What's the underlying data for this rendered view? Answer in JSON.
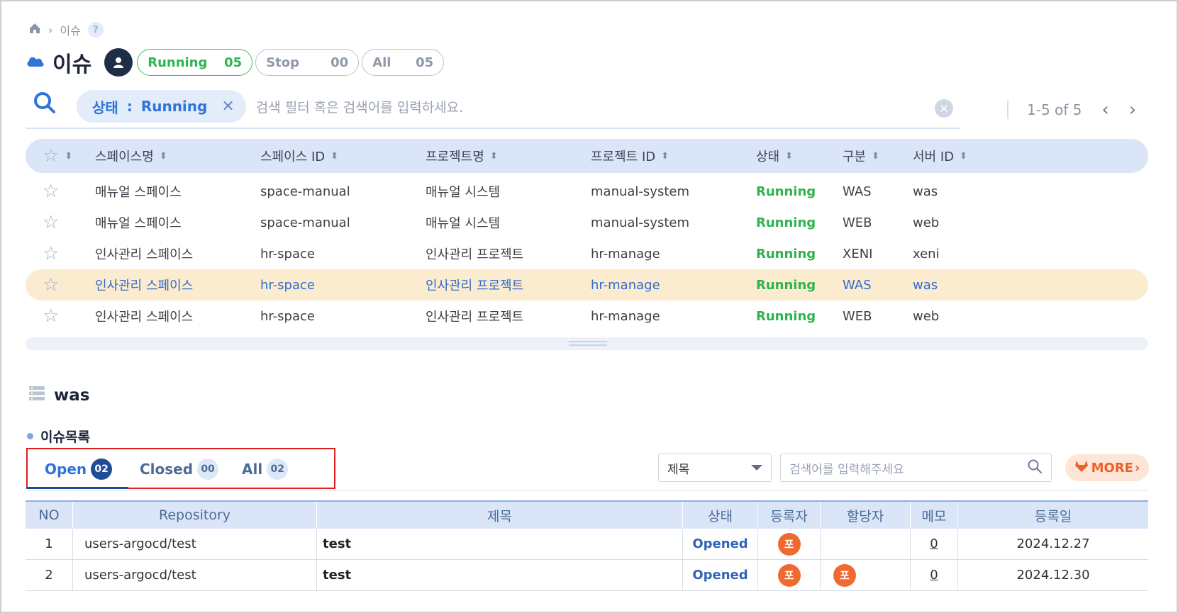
{
  "breadcrumb": {
    "current": "이슈",
    "help": "?"
  },
  "header": {
    "title": "이슈",
    "pills": [
      {
        "label": "Running",
        "count": "05"
      },
      {
        "label": "Stop",
        "count": "00"
      },
      {
        "label": "All",
        "count": "05"
      }
    ]
  },
  "search": {
    "filter_label": "상태",
    "filter_sep": ":",
    "filter_value": "Running",
    "placeholder": "검색 필터 혹은 검색어를 입력하세요."
  },
  "pagination": {
    "range": "1-5 of 5"
  },
  "space_table": {
    "columns": [
      "스페이스명",
      "스페이스 ID",
      "프로젝트명",
      "프로젝트 ID",
      "상태",
      "구분",
      "서버 ID"
    ],
    "rows": [
      [
        "매뉴얼 스페이스",
        "space-manual",
        "매뉴얼 시스템",
        "manual-system",
        "Running",
        "WAS",
        "was"
      ],
      [
        "매뉴얼 스페이스",
        "space-manual",
        "매뉴얼 시스템",
        "manual-system",
        "Running",
        "WEB",
        "web"
      ],
      [
        "인사관리 스페이스",
        "hr-space",
        "인사관리 프로젝트",
        "hr-manage",
        "Running",
        "XENI",
        "xeni"
      ],
      [
        "인사관리 스페이스",
        "hr-space",
        "인사관리 프로젝트",
        "hr-manage",
        "Running",
        "WAS",
        "was"
      ],
      [
        "인사관리 스페이스",
        "hr-space",
        "인사관리 프로젝트",
        "hr-manage",
        "Running",
        "WEB",
        "web"
      ]
    ],
    "selected_row": 3
  },
  "server": {
    "name": "was"
  },
  "issues": {
    "section_title": "이슈목록",
    "tabs": [
      {
        "label": "Open",
        "count": "02"
      },
      {
        "label": "Closed",
        "count": "00"
      },
      {
        "label": "All",
        "count": "02"
      }
    ],
    "select_value": "제목",
    "search_placeholder": "검색어를 입력해주세요",
    "more_label": "MORE",
    "columns": [
      "NO",
      "Repository",
      "제목",
      "상태",
      "등록자",
      "할당자",
      "메모",
      "등록일"
    ],
    "rows": [
      {
        "no": "1",
        "repository": "users-argocd/test",
        "title": "test",
        "status": "Opened",
        "registrant": "포",
        "assignee": "",
        "memo": "0",
        "date": "2024.12.27"
      },
      {
        "no": "2",
        "repository": "users-argocd/test",
        "title": "test",
        "status": "Opened",
        "registrant": "포",
        "assignee": "포",
        "memo": "0",
        "date": "2024.12.30"
      }
    ]
  },
  "colors": {
    "accent": "#2f74d8",
    "running_green": "#2fb34f",
    "highlight_row": "#fbebcf",
    "navy": "#1f4c95",
    "avatar_orange": "#ef6a30"
  }
}
